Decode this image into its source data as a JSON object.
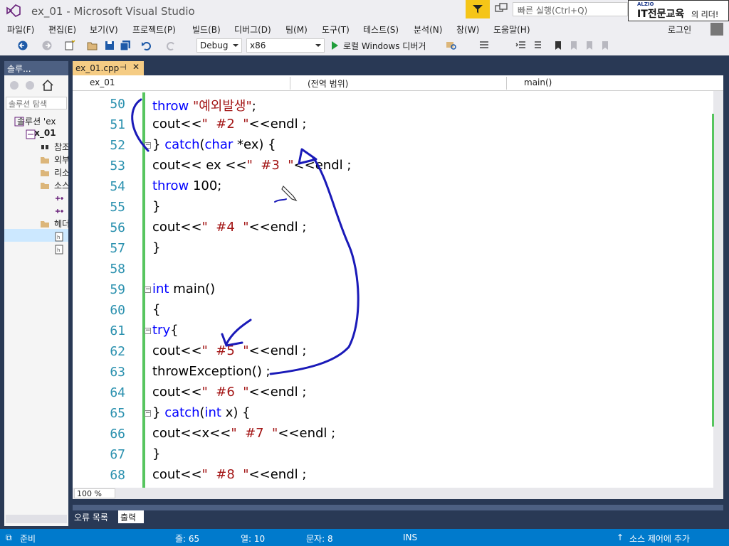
{
  "window": {
    "title": "ex_01 - Microsoft Visual Studio",
    "quick_launch_placeholder": "빠른 실행(Ctrl+Q)"
  },
  "brand": {
    "small": "ALZIO",
    "big": "IT전문교육",
    "tail": "의 리더!"
  },
  "menu": [
    "파일(F)",
    "편집(E)",
    "보기(V)",
    "프로젝트(P)",
    "빌드(B)",
    "디버그(D)",
    "팀(M)",
    "도구(T)",
    "테스트(S)",
    "분석(N)",
    "창(W)",
    "도움말(H)"
  ],
  "login": "로그인",
  "toolbar": {
    "config": "Debug",
    "platform": "x86",
    "run_label": "로컬 Windows 디버거"
  },
  "solution_explorer": {
    "title": "솔루...",
    "search_placeholder": "솔루션 탐색",
    "items": [
      {
        "label": "솔루션 'ex"
      },
      {
        "label": "ex_01"
      },
      {
        "label": "참조"
      },
      {
        "label": "외부"
      },
      {
        "label": "리소"
      },
      {
        "label": "소스"
      },
      {
        "label": ""
      },
      {
        "label": ""
      },
      {
        "label": "헤더"
      },
      {
        "label": ""
      },
      {
        "label": ""
      }
    ]
  },
  "editor": {
    "tab_label": "ex_01.cpp",
    "nav": {
      "project": "ex_01",
      "scope": "(전역 범위)",
      "member": "main()"
    },
    "zoom": "100 %",
    "lines": [
      {
        "n": "50",
        "segs": [
          {
            "t": "throw",
            "c": "kw"
          },
          {
            "t": " \"예외발생\"",
            "c": "str"
          },
          {
            "t": ";",
            "c": ""
          }
        ]
      },
      {
        "n": "51",
        "segs": [
          {
            "t": "cout<<",
            "c": ""
          },
          {
            "t": "\"  #2  \"",
            "c": "str"
          },
          {
            "t": "<<endl ;",
            "c": ""
          }
        ]
      },
      {
        "n": "52",
        "segs": [
          {
            "t": "} ",
            "c": ""
          },
          {
            "t": "catch",
            "c": "kw"
          },
          {
            "t": "(",
            "c": ""
          },
          {
            "t": "char",
            "c": "kw"
          },
          {
            "t": " *ex) {",
            "c": ""
          }
        ]
      },
      {
        "n": "53",
        "segs": [
          {
            "t": "cout<< ex <<",
            "c": ""
          },
          {
            "t": "\"  #3  \"",
            "c": "str"
          },
          {
            "t": "<<endl ;",
            "c": ""
          }
        ]
      },
      {
        "n": "54",
        "segs": [
          {
            "t": "throw",
            "c": "kw"
          },
          {
            "t": " 100;",
            "c": ""
          }
        ]
      },
      {
        "n": "55",
        "segs": [
          {
            "t": "}",
            "c": ""
          }
        ]
      },
      {
        "n": "56",
        "segs": [
          {
            "t": "cout<<",
            "c": ""
          },
          {
            "t": "\"  #4  \"",
            "c": "str"
          },
          {
            "t": "<<endl ;",
            "c": ""
          }
        ]
      },
      {
        "n": "57",
        "segs": [
          {
            "t": "}",
            "c": ""
          }
        ]
      },
      {
        "n": "58",
        "segs": []
      },
      {
        "n": "59",
        "segs": [
          {
            "t": "int",
            "c": "kw"
          },
          {
            "t": " main()",
            "c": ""
          }
        ]
      },
      {
        "n": "60",
        "segs": [
          {
            "t": "{",
            "c": ""
          }
        ]
      },
      {
        "n": "61",
        "segs": [
          {
            "t": "try",
            "c": "kw"
          },
          {
            "t": "{",
            "c": ""
          }
        ]
      },
      {
        "n": "62",
        "segs": [
          {
            "t": "cout<<",
            "c": ""
          },
          {
            "t": "\"  #5  \"",
            "c": "str"
          },
          {
            "t": "<<endl ;",
            "c": ""
          }
        ]
      },
      {
        "n": "63",
        "segs": [
          {
            "t": "throwException() ;",
            "c": ""
          }
        ]
      },
      {
        "n": "64",
        "segs": [
          {
            "t": "cout<<",
            "c": ""
          },
          {
            "t": "\"  #6  \"",
            "c": "str"
          },
          {
            "t": "<<endl ;",
            "c": ""
          }
        ]
      },
      {
        "n": "65",
        "segs": [
          {
            "t": "} ",
            "c": ""
          },
          {
            "t": "catch",
            "c": "kw"
          },
          {
            "t": "(",
            "c": ""
          },
          {
            "t": "int",
            "c": "kw"
          },
          {
            "t": " x) {",
            "c": ""
          }
        ]
      },
      {
        "n": "66",
        "segs": [
          {
            "t": "cout<<x<<",
            "c": ""
          },
          {
            "t": "\"  #7  \"",
            "c": "str"
          },
          {
            "t": "<<endl ;",
            "c": ""
          }
        ]
      },
      {
        "n": "67",
        "segs": [
          {
            "t": "}",
            "c": ""
          }
        ]
      },
      {
        "n": "68",
        "segs": [
          {
            "t": "cout<<",
            "c": ""
          },
          {
            "t": "\"  #8  \"",
            "c": "str"
          },
          {
            "t": "<<endl ;",
            "c": ""
          }
        ]
      }
    ]
  },
  "output_tabs": {
    "errors": "오류 목록",
    "output": "출력"
  },
  "status": {
    "ready": "준비",
    "line": "줄: 65",
    "col": "열: 10",
    "char": "문자: 8",
    "mode": "INS",
    "scm": "소스 제어에 추가"
  },
  "colors": {
    "status_bg": "#007acc",
    "frame_bg": "#293955",
    "keyword": "#0000ff",
    "string": "#a31515",
    "line_number": "#2b91af",
    "annotation": "#1a1ab8"
  }
}
